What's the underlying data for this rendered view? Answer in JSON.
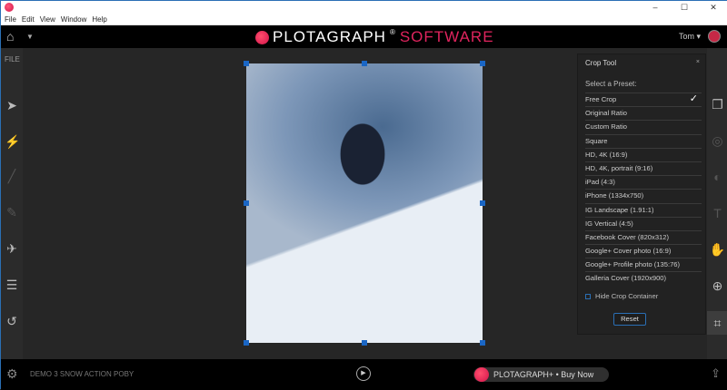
{
  "menu": [
    "File",
    "Edit",
    "View",
    "Window",
    "Help"
  ],
  "brand": {
    "name": "PLOTAGRAPH",
    "suffix": "SOFTWARE",
    "reg": "®"
  },
  "user": {
    "name": "Tom"
  },
  "left": {
    "file_label": "FILE"
  },
  "crop": {
    "title": "Crop Tool",
    "close": "×",
    "select_label": "Select a Preset:",
    "presets": [
      "Free Crop",
      "Original Ratio",
      "Custom Ratio",
      "Square",
      "HD, 4K (16:9)",
      "HD, 4K, portrait (9:16)",
      "iPad (4:3)",
      "iPhone (1334x750)",
      "IG Landscape (1.91:1)",
      "IG Vertical (4:5)",
      "Facebook Cover (820x312)",
      "Google+ Cover photo (16:9)",
      "Google+ Profile photo (135:76)",
      "Galleria Cover (1920x900)"
    ],
    "selected": "Free Crop",
    "hide_label": "Hide Crop Container",
    "reset": "Reset"
  },
  "bottom": {
    "project": "DEMO 3 SNOW ACTION POBY",
    "buy": "PLOTAGRAPH+ • Buy Now"
  },
  "window": {
    "min": "–",
    "max": "☐",
    "close": "✕"
  }
}
